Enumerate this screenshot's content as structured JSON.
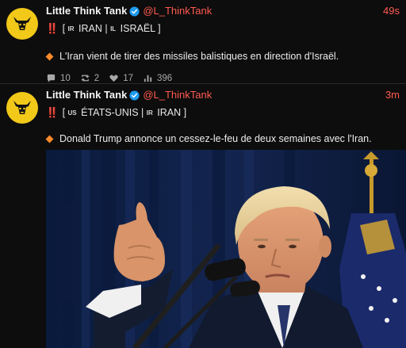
{
  "tweets": [
    {
      "name": "Little Think Tank",
      "handle": "@L_ThinkTank",
      "time": "49s",
      "alert": "‼️",
      "tag_parts": [
        {
          "flag": "IR",
          "text": " IRAN | "
        },
        {
          "flag": "IL",
          "text": " ISRAËL ]"
        }
      ],
      "bracket_open": "[ ",
      "text": "L'Iran vient de tirer des missiles balistiques en direction d'Israël.",
      "replies": "10",
      "retweets": "2",
      "likes": "17",
      "views": "396"
    },
    {
      "name": "Little Think Tank",
      "handle": "@L_ThinkTank",
      "time": "3m",
      "alert": "‼️",
      "tag_parts": [
        {
          "flag": "US",
          "text": " ÉTATS-UNIS | "
        },
        {
          "flag": "IR",
          "text": " IRAN ]"
        }
      ],
      "bracket_open": "[ ",
      "text": "Donald Trump annonce un cessez-le-feu de deux semaines avec l'Iran.",
      "media_icon": "photo-of-speaker-at-podium"
    }
  ],
  "colors": {
    "background": "#0d0d0d",
    "avatar": "#f2c819",
    "handle": "#ff5a4f",
    "alert": "#e3261b",
    "diamond": "#ff8a2a",
    "verified": "#1d9bf0"
  },
  "icons": {
    "avatar": "cow-head-logo-icon",
    "verified": "verified-badge-icon",
    "reply": "speech-bubble-icon",
    "retweet": "retweet-icon",
    "like": "heart-icon",
    "views": "bar-chart-icon"
  }
}
